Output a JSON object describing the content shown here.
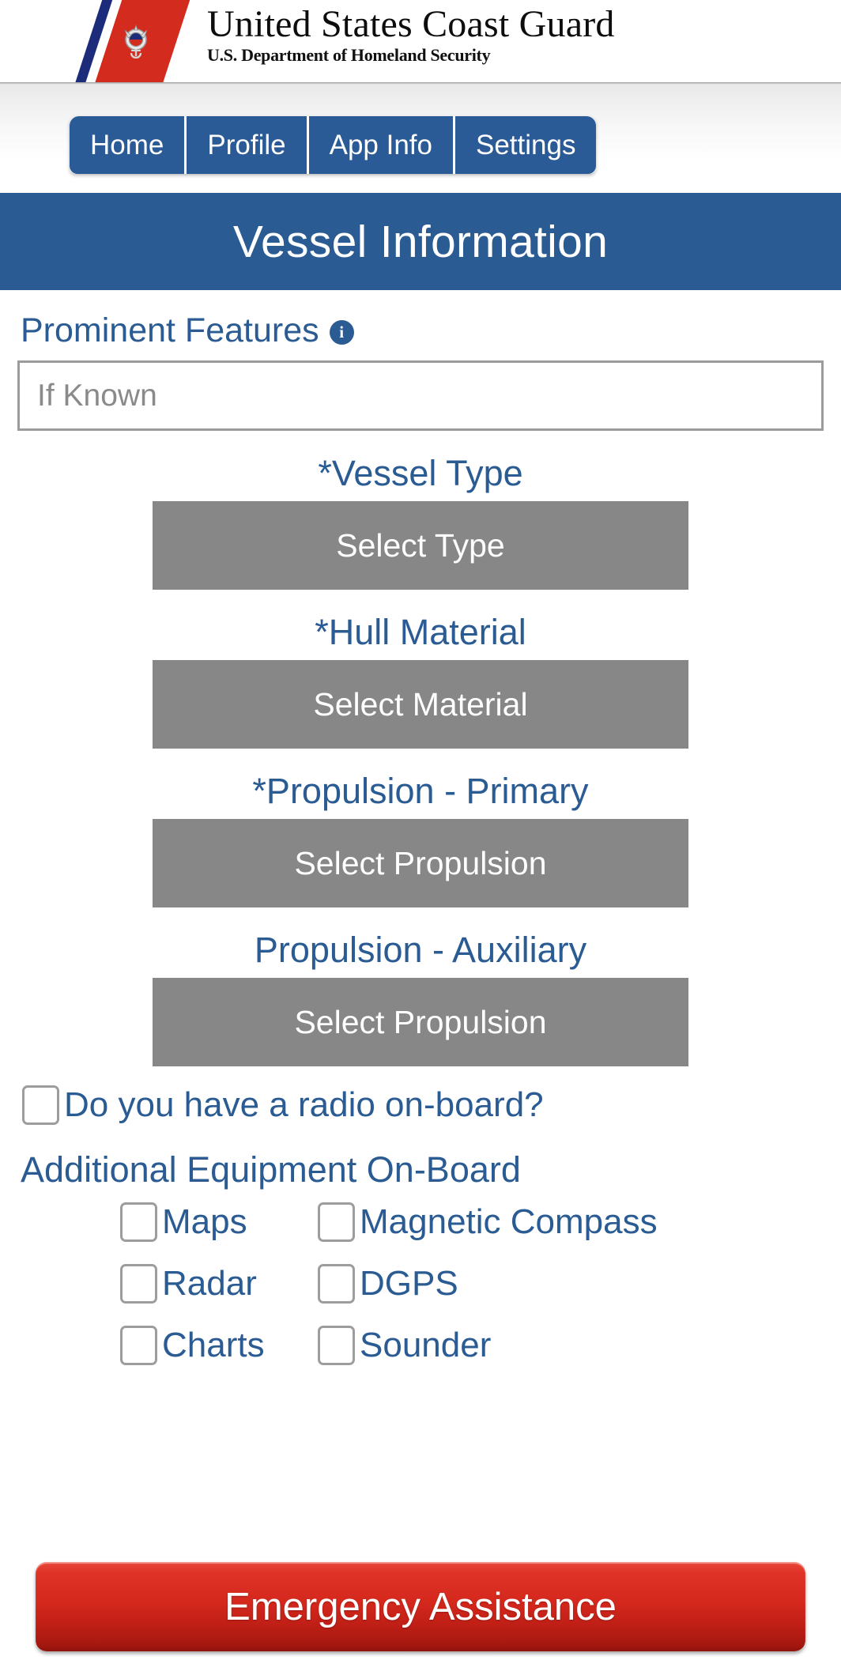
{
  "header": {
    "agency_title": "United States Coast Guard",
    "agency_subtitle": "U.S. Department of Homeland Security",
    "logo_icon": "coast-guard-racing-stripe-emblem"
  },
  "nav": {
    "items": [
      {
        "label": "Home"
      },
      {
        "label": "Profile"
      },
      {
        "label": "App Info"
      },
      {
        "label": "Settings"
      }
    ]
  },
  "page": {
    "banner_title": "Vessel Information"
  },
  "prominent_features": {
    "label": "Prominent Features",
    "info_icon": "info-circle-icon",
    "info_glyph": "i",
    "placeholder": "If Known",
    "value": ""
  },
  "fields": [
    {
      "title": "*Vessel Type",
      "button_label": "Select Type"
    },
    {
      "title": "*Hull Material",
      "button_label": "Select Material"
    },
    {
      "title": "*Propulsion - Primary",
      "button_label": "Select Propulsion"
    },
    {
      "title": "Propulsion - Auxiliary",
      "button_label": "Select Propulsion"
    }
  ],
  "radio_question": {
    "label": "Do you have a radio on-board?",
    "checked": false
  },
  "additional_equipment": {
    "title": "Additional Equipment On-Board",
    "items": [
      {
        "label": "Maps",
        "checked": false
      },
      {
        "label": "Magnetic Compass",
        "checked": false
      },
      {
        "label": "Radar",
        "checked": false
      },
      {
        "label": "DGPS",
        "checked": false
      },
      {
        "label": "Charts",
        "checked": false
      },
      {
        "label": "Sounder",
        "checked": false
      }
    ]
  },
  "emergency": {
    "label": "Emergency Assistance"
  },
  "colors": {
    "brand_blue": "#2a5b92",
    "nav_blue": "#2a5b96",
    "select_gray": "#878787",
    "emergency_red": "#d5281d",
    "stripe_red": "#d32b1e",
    "stripe_blue": "#1c2c7a"
  }
}
